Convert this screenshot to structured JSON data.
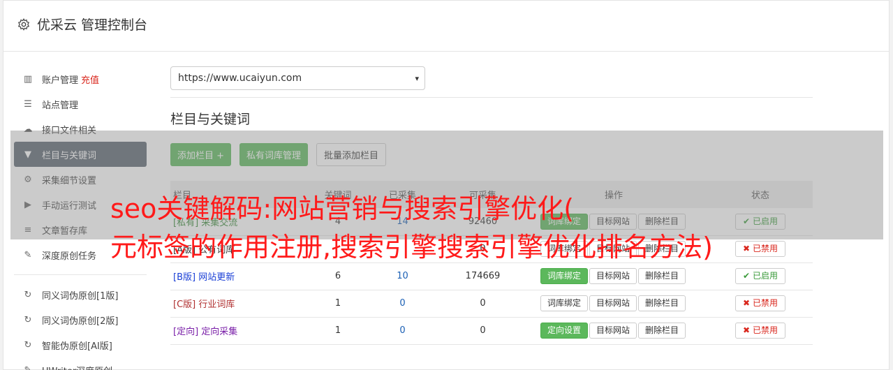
{
  "app": {
    "title": "优采云 管理控制台",
    "icon": "gear-icon"
  },
  "sidebar": {
    "items": [
      {
        "label": "账户管理",
        "extra": "充值",
        "icon": "bar-chart-icon"
      },
      {
        "label": "站点管理",
        "icon": "server-icon"
      },
      {
        "label": "接口文件相关",
        "icon": "cloud-upload-icon"
      },
      {
        "label": "栏目与关键词",
        "icon": "filter-icon",
        "active": true
      },
      {
        "label": "采集细节设置",
        "icon": "cogs-icon"
      },
      {
        "label": "手动运行测试",
        "icon": "play-icon"
      },
      {
        "label": "文章暂存库",
        "icon": "database-icon"
      },
      {
        "label": "深度原创任务",
        "icon": "edit-icon"
      },
      {
        "label": "同义词伪原创[1版]",
        "icon": "refresh-icon"
      },
      {
        "label": "同义词伪原创[2版]",
        "icon": "refresh-icon"
      },
      {
        "label": "智能伪原创[AI版]",
        "icon": "refresh-icon"
      },
      {
        "label": "UWriter深度原创",
        "icon": "edit-icon"
      }
    ]
  },
  "main": {
    "site_select": {
      "value": "https://www.ucaiyun.com"
    },
    "section_title": "栏目与关键词",
    "buttons": {
      "add_column": "添加栏目 +",
      "private_lib": "私有词库管理",
      "batch_add": "批量添加栏目"
    },
    "table": {
      "headers": [
        "栏目",
        "关键词",
        "已采集",
        "可采集",
        "操作",
        "状态"
      ],
      "rows": [
        {
          "tag": "[私有]",
          "name": "采集交流",
          "c1": "4",
          "c2": "14",
          "c3": "92460",
          "btn1": "词库绑定",
          "btn1_green": true,
          "btn2": "目标网站",
          "btn3": "删除栏目",
          "status": "已启用",
          "on": true,
          "color": "#3a8a3a"
        },
        {
          "tag": "[A版]",
          "name": "公有词库",
          "c1": "",
          "c2": "",
          "c3": "0",
          "btn1": "词库绑定",
          "btn1_green": false,
          "btn2": "目标网站",
          "btn3": "删除栏目",
          "status": "已禁用",
          "on": false,
          "color": "#333333"
        },
        {
          "tag": "[B版]",
          "name": "网站更新",
          "c1": "6",
          "c2": "10",
          "c3": "174669",
          "btn1": "词库绑定",
          "btn1_green": true,
          "btn2": "目标网站",
          "btn3": "删除栏目",
          "status": "已启用",
          "on": true,
          "color": "#1a3fd6"
        },
        {
          "tag": "[C版]",
          "name": "行业词库",
          "c1": "1",
          "c2": "0",
          "c3": "0",
          "btn1": "词库绑定",
          "btn1_green": false,
          "btn2": "目标网站",
          "btn3": "删除栏目",
          "status": "已禁用",
          "on": false,
          "color": "#b03030"
        },
        {
          "tag": "[定向]",
          "name": "定向采集",
          "c1": "1",
          "c2": "0",
          "c3": "0",
          "btn1": "定向设置",
          "btn1_green": true,
          "btn2": "目标网站",
          "btn3": "删除栏目",
          "status": "已禁用",
          "on": false,
          "color": "#7a1fa8"
        }
      ]
    }
  },
  "overlay": {
    "line1": "seo关键解码:网站营销与搜索引擎优化(",
    "line2": "元标签的作用注册,搜索引擎搜索引擎优化排名方法)"
  }
}
